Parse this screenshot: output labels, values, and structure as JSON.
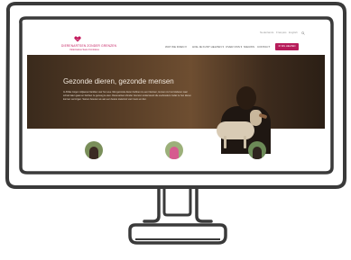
{
  "site": {
    "logo": {
      "name": "DIERENARTSEN ZONDER GRENZEN",
      "tagline": "Vétérinaires Sans Frontières"
    },
    "top_links": [
      "Nederlands",
      "Français",
      "English"
    ],
    "top_search_icon": "search-icon",
    "nav": [
      "WAT WE DOEN ▾",
      "HOE JE KUNT HELPEN ▾",
      "OVER ONS ▾",
      "NIEUWS",
      "CONTACT"
    ],
    "cta_label": "IK WIL HELPEN",
    "hero": {
      "title": "Gezonde dieren, gezonde mensen",
      "lines": [
        "In Afrika zorgen miljoenen families voor hun vee. Met gezonde dieren hebben ze een inkomen, kunnen ze hun kinderen naar",
        "school laten gaan en hebben ze genoeg te eten. Dierenartsen Zonder Grenzen ondersteunt die veehouders zodat ze hun dieren",
        "kunnen verzorgen. Samen bouwen we aan een betere toekomst voor mens en dier."
      ]
    },
    "features": [
      "feature-image-1",
      "feature-image-2",
      "feature-image-3"
    ]
  },
  "colors": {
    "brand": "#b71c5a",
    "monitor_outline": "#3a3a3a",
    "monitor_fill": "#ffffff"
  }
}
